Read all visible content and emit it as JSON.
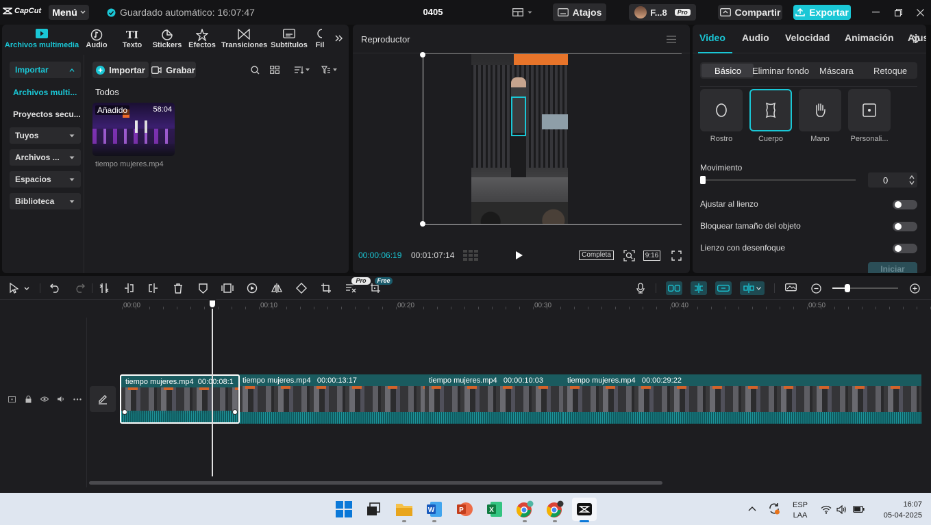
{
  "app": {
    "logo_text": "CapCut",
    "menu_label": "Menú",
    "autosave_text": "Guardado automático: 16:07:47",
    "project_title": "0405",
    "shortcuts_label": "Atajos",
    "user_name": "F...8",
    "pro_badge": "Pro",
    "share_label": "Compartir",
    "export_label": "Exportar",
    "accent_color": "#1ac7d6"
  },
  "media_tabs": [
    {
      "label": "Archivos multimedia",
      "icon": "media-icon"
    },
    {
      "label": "Audio",
      "icon": "audio-icon"
    },
    {
      "label": "Texto",
      "icon": "text-icon"
    },
    {
      "label": "Stickers",
      "icon": "sticker-icon"
    },
    {
      "label": "Efectos",
      "icon": "effects-icon"
    },
    {
      "label": "Transiciones",
      "icon": "transitions-icon"
    },
    {
      "label": "Subtítulos",
      "icon": "subtitles-icon"
    },
    {
      "label": "Fil",
      "icon": "filters-icon"
    }
  ],
  "sidebar": {
    "import": "Importar",
    "media_files": "Archivos multi...",
    "secondary_projects": "Proyectos secu...",
    "yours": "Tuyos",
    "files": "Archivos ...",
    "spaces": "Espacios",
    "library": "Biblioteca"
  },
  "library": {
    "import_button": "Importar",
    "record_button": "Grabar",
    "section_title": "Todos",
    "item": {
      "badge": "Añadido",
      "duration": "58:04",
      "filename": "tiempo mujeres.mp4"
    }
  },
  "player": {
    "title": "Reproductor",
    "current_time": "00:00:06:19",
    "total_time": "00:01:07:14",
    "quality": "Completa",
    "ratio": "9:16"
  },
  "right_panel": {
    "tabs": [
      "Video",
      "Audio",
      "Velocidad",
      "Animación",
      "Ajus"
    ],
    "sub_tabs": [
      "Básico",
      "Eliminar fondo",
      "Máscara",
      "Retoque"
    ],
    "effects": [
      "Rostro",
      "Cuerpo",
      "Mano",
      "Personali..."
    ],
    "movement_label": "Movimiento",
    "movement_value": "0",
    "fit_canvas": "Ajustar al lienzo",
    "lock_size": "Bloquear tamaño del objeto",
    "blur_canvas": "Lienzo con desenfoque",
    "start_button": "Iniciar"
  },
  "toolbar_badges": {
    "pro": "Pro",
    "free": "Free"
  },
  "timeline": {
    "ticks": [
      "00:00",
      "00:10",
      "00:20",
      "00:30",
      "00:40",
      "00:50"
    ],
    "clips": [
      {
        "name": "tiempo mujeres.mp4",
        "duration": "00:00:08:1"
      },
      {
        "name": "tiempo mujeres.mp4",
        "duration": "00:00:13:17"
      },
      {
        "name": "tiempo mujeres.mp4",
        "duration": "00:00:10:03"
      },
      {
        "name": "tiempo mujeres.mp4",
        "duration": "00:00:29:22"
      }
    ]
  },
  "taskbar": {
    "lang": "ESP",
    "layout": "LAA",
    "time": "16:07",
    "date": "05-04-2025"
  }
}
